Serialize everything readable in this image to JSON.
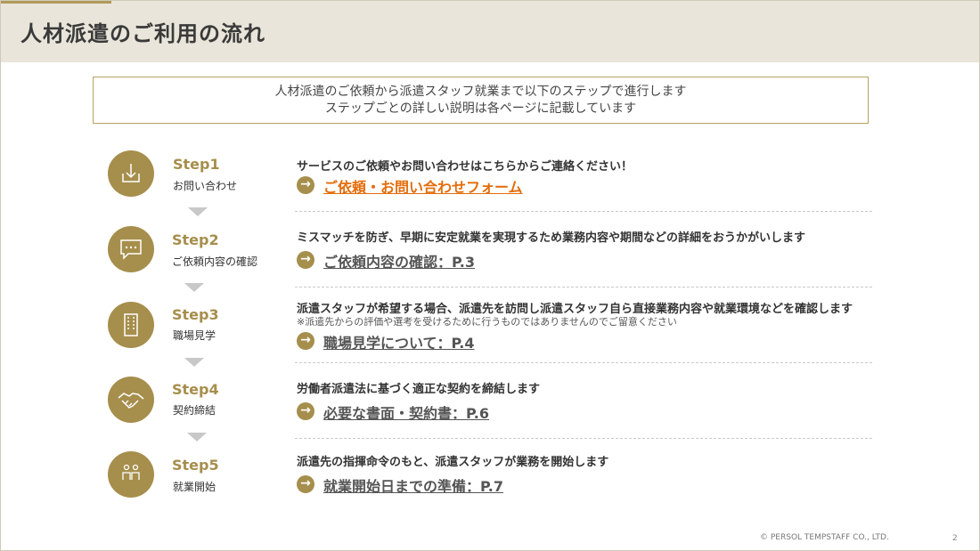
{
  "page": {
    "title": "人材派遣のご利用の流れ",
    "intro": [
      "人材派遣のご依頼から派遣スタッフ就業まで以下のステップで進行します",
      "ステップごとの詳しい説明は各ページに記載しています"
    ],
    "footer": "© PERSOL TEMPSTAFF CO., LTD.",
    "page_number": "2"
  },
  "colors": {
    "accent": "#a68e4c",
    "header_bg": "#e9e5da",
    "link_orange": "#e46c0a"
  },
  "steps": [
    {
      "num": "Step1",
      "label": "お問い合わせ",
      "icon": "download-icon",
      "desc": "サービスのご依頼やお問い合わせはこちらからご連絡ください！",
      "link": "ご依頼・お問い合わせフォーム"
    },
    {
      "num": "Step2",
      "label": "ご依頼内容の確認",
      "icon": "chat-bubble-icon",
      "desc": "ミスマッチを防ぎ、早期に安定就業を実現するため業務内容や期間などの詳細をおうかがいします",
      "link": "ご依頼内容の確認：P.3"
    },
    {
      "num": "Step3",
      "label": "職場見学",
      "icon": "building-icon",
      "desc": "派遣スタッフが希望する場合、派遣先を訪問し派遣スタッフ自ら直接業務内容や就業環境などを確認します",
      "note": "※派遣先からの評価や選考を受けるために行うものではありませんのでご留意ください",
      "link": "職場見学について：P.4"
    },
    {
      "num": "Step4",
      "label": "契約締結",
      "icon": "handshake-icon",
      "desc": "労働者派遣法に基づく適正な契約を締結します",
      "link": "必要な書面・契約書：P.6"
    },
    {
      "num": "Step5",
      "label": "就業開始",
      "icon": "people-icon",
      "desc": "派遣先の指揮命令のもと、派遣スタッフが業務を開始します",
      "link": "就業開始日までの準備：P.7"
    }
  ]
}
